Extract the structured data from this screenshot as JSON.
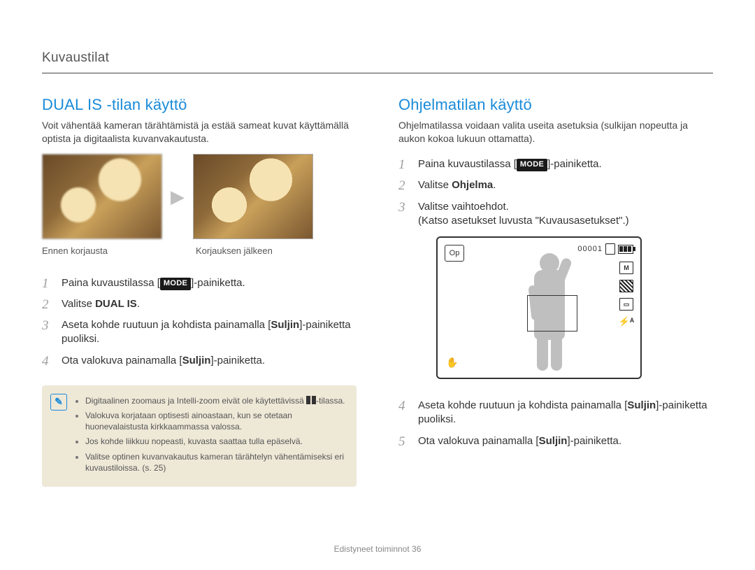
{
  "section_header": "Kuvaustilat",
  "left": {
    "title": "DUAL IS -tilan käyttö",
    "intro": "Voit vähentää kameran tärähtämistä ja estää sameat kuvat käyttämällä optista ja digitaalista kuvanvakautusta.",
    "caption_before": "Ennen korjausta",
    "caption_after": "Korjauksen jälkeen",
    "steps": {
      "s1_pre": "Paina kuvaustilassa [",
      "mode": "MODE",
      "s1_post": "]-painiketta.",
      "s2": "Valitse ",
      "s2_bold": "DUAL IS",
      "s2_end": ".",
      "s3_a": "Aseta kohde ruutuun ja kohdista painamalla [",
      "s3_bold": "Suljin",
      "s3_b": "]-painiketta puoliksi.",
      "s4_a": "Ota valokuva painamalla [",
      "s4_bold": "Suljin",
      "s4_b": "]-painiketta."
    },
    "notes": [
      "Digitaalinen zoomaus ja Intelli-zoom eivät ole käytettävissä ",
      "-tilassa.",
      "Valokuva korjataan optisesti ainoastaan, kun se otetaan huonevalaistusta kirkkaammassa valossa.",
      "Jos kohde liikkuu nopeasti, kuvasta saattaa tulla epäselvä.",
      "Valitse optinen kuvanvakautus kameran tärähtelyn vähentämiseksi eri kuvaustiloissa. (s. 25)"
    ]
  },
  "right": {
    "title": "Ohjelmatilan käyttö",
    "intro": "Ohjelmatilassa voidaan valita useita asetuksia (sulkijan nopeutta ja aukon kokoa lukuun ottamatta).",
    "steps": {
      "s1_pre": "Paina kuvaustilassa [",
      "mode": "MODE",
      "s1_post": "]-painiketta.",
      "s2": "Valitse ",
      "s2_bold": "Ohjelma",
      "s2_end": ".",
      "s3_a": "Valitse vaihtoehdot.",
      "s3_b": "(Katso asetukset luvusta \"Kuvausasetukset\".)",
      "s4_a": "Aseta kohde ruutuun ja kohdista painamalla [",
      "s4_bold": "Suljin",
      "s4_b": "]-painiketta puoliksi.",
      "s5_a": "Ota valokuva painamalla [",
      "s5_bold": "Suljin",
      "s5_b": "]-painiketta."
    },
    "lcd": {
      "corner": "Op",
      "counter": "00001",
      "icon_m": "M"
    }
  },
  "footer_text": "Edistyneet toiminnot",
  "footer_page": "36"
}
